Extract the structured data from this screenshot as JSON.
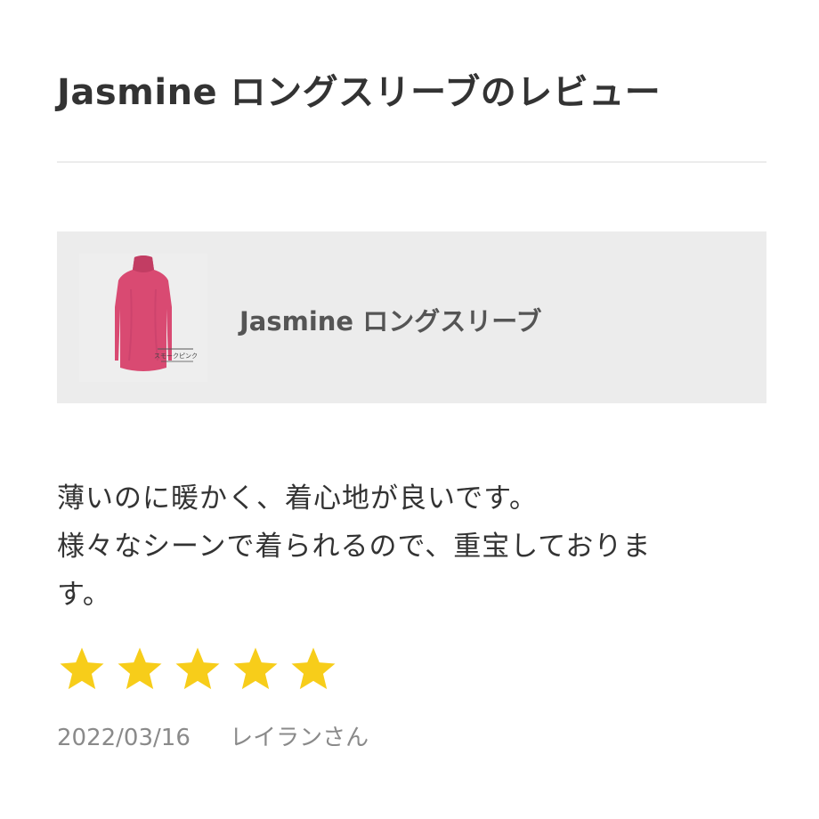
{
  "page": {
    "title": "Jasmine ロングスリーブのレビュー"
  },
  "product": {
    "name": "Jasmine ロングスリーブ",
    "thumbnail_caption": "スモークピンク",
    "thumbnail_icon": "pink-turtleneck-shirt-image"
  },
  "review": {
    "body_lines": [
      "薄いのに暖かく、着心地が良いです。",
      "様々なシーンで着られるので、重宝しておりま",
      "す。"
    ],
    "rating": {
      "value": 5,
      "max": 5,
      "star_color": "#f7cd1a"
    },
    "date": "2022/03/16",
    "author": "レイランさん"
  }
}
